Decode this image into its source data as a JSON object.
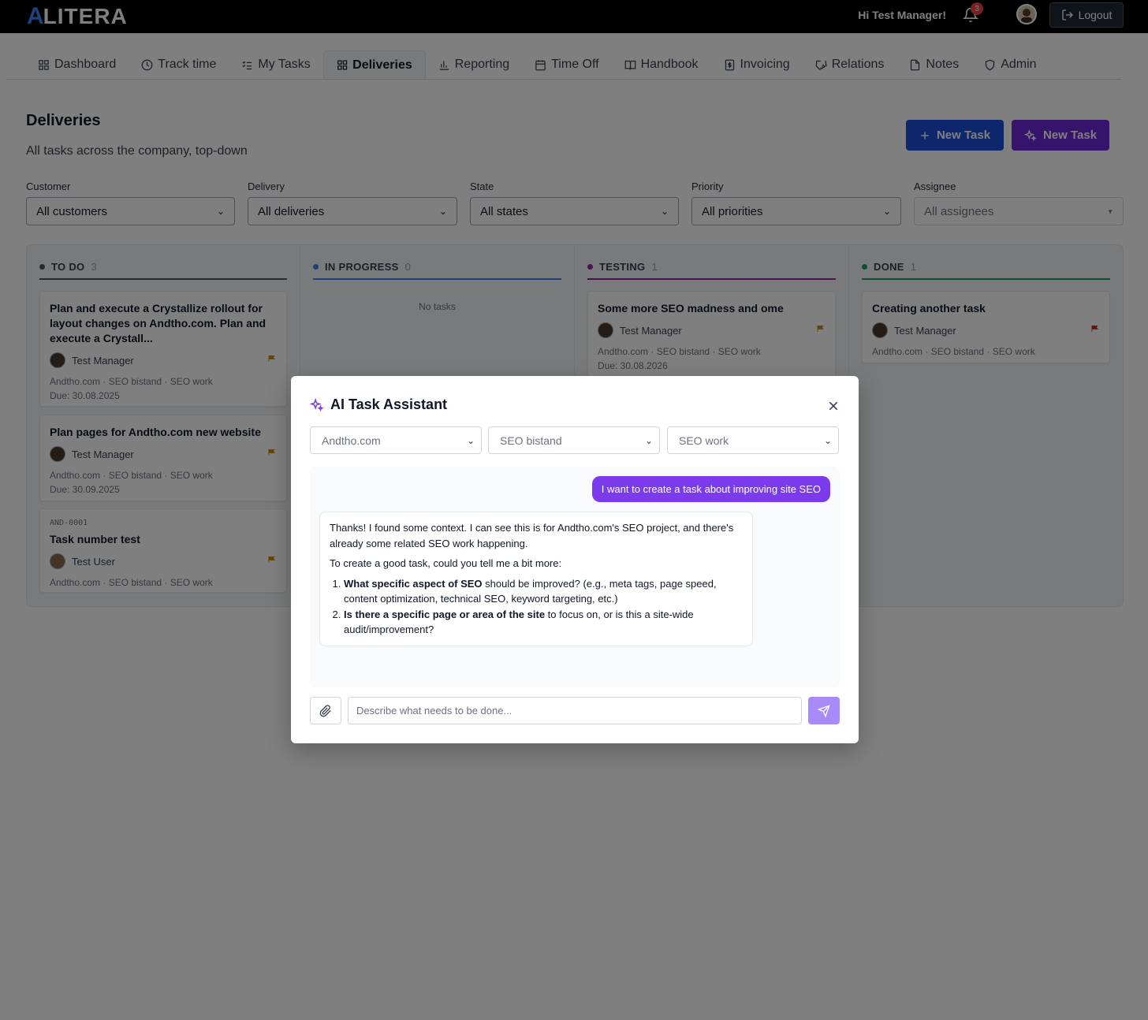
{
  "header": {
    "logo": "LITERA",
    "logo_mark": "A",
    "greeting": "Hi Test Manager!",
    "notification_count": "3",
    "logout_label": "Logout"
  },
  "tabs": [
    {
      "label": "Dashboard",
      "icon": "grid-icon"
    },
    {
      "label": "Track time",
      "icon": "clock-icon"
    },
    {
      "label": "My Tasks",
      "icon": "checklist-icon"
    },
    {
      "label": "Deliveries",
      "icon": "grid-icon",
      "active": true
    },
    {
      "label": "Reporting",
      "icon": "bar-chart-icon"
    },
    {
      "label": "Time Off",
      "icon": "calendar-icon"
    },
    {
      "label": "Handbook",
      "icon": "book-icon"
    },
    {
      "label": "Invoicing",
      "icon": "invoice-icon"
    },
    {
      "label": "Relations",
      "icon": "handshake-icon"
    },
    {
      "label": "Notes",
      "icon": "note-icon"
    },
    {
      "label": "Admin",
      "icon": "shield-icon"
    }
  ],
  "page": {
    "title": "Deliveries",
    "subtitle": "All tasks across the company, top-down",
    "new_task_label": "New Task",
    "ai_new_task_label": "New Task"
  },
  "filters": {
    "customer": {
      "label": "Customer",
      "value": "All customers"
    },
    "delivery": {
      "label": "Delivery",
      "value": "All deliveries"
    },
    "state": {
      "label": "State",
      "value": "All states"
    },
    "priority": {
      "label": "Priority",
      "value": "All priorities"
    },
    "assignee": {
      "label": "Assignee",
      "value": "All assignees"
    }
  },
  "columns": {
    "todo": {
      "label": "TO DO",
      "count": "3",
      "color": "#4b5563"
    },
    "in_progress": {
      "label": "IN PROGRESS",
      "count": "0",
      "color": "#3b82f6",
      "empty": "No tasks"
    },
    "testing": {
      "label": "TESTING",
      "count": "1",
      "color": "#a21caf"
    },
    "done": {
      "label": "DONE",
      "count": "1",
      "color": "#16a34a"
    }
  },
  "cards": {
    "todo_1": {
      "title": "Plan and execute a Crystallize rollout for layout changes on Andtho.com. Plan and execute a Crystall...",
      "user": "Test Manager",
      "meta": "Andtho.com · SEO bistand · SEO work",
      "due": "Due: 30.08.2025"
    },
    "todo_2": {
      "title": "Plan pages for Andtho.com new website",
      "user": "Test Manager",
      "meta": "Andtho.com · SEO bistand · SEO work",
      "due": "Due: 30.09.2025"
    },
    "todo_3": {
      "code": "AND-0001",
      "title": "Task number test",
      "user": "Test User",
      "meta": "Andtho.com · SEO bistand · SEO work"
    },
    "testing_1": {
      "title": "Some more SEO madness and ome",
      "user": "Test Manager",
      "meta": "Andtho.com · SEO bistand · SEO work",
      "due": "Due: 30.08.2026"
    },
    "done_1": {
      "title": "Creating another task",
      "user": "Test Manager",
      "meta": "Andtho.com · SEO bistand · SEO work"
    }
  },
  "modal": {
    "title": "AI Task Assistant",
    "selects": {
      "customer": "Andtho.com",
      "delivery": "SEO bistand",
      "workstream": "SEO work"
    },
    "user_message": "I want to create a task about improving site SEO",
    "ai_message": {
      "intro": "Thanks! I found some context. I can see this is for Andtho.com's SEO project, and there's already some related SEO work happening.",
      "ask": "To create a good task, could you tell me a bit more:",
      "q1_bold": "What specific aspect of SEO",
      "q1_rest": " should be improved? (e.g., meta tags, page speed, content optimization, technical SEO, keyword targeting, etc.)",
      "q2_bold": "Is there a specific page or area of the site",
      "q2_rest": " to focus on, or is this a site-wide audit/improvement?"
    },
    "input_placeholder": "Describe what needs to be done..."
  },
  "colors": {
    "primary": "#1d4ed8",
    "ai_purple": "#7c3aed",
    "flag_medium": "#ca8a04",
    "flag_high": "#dc2626"
  }
}
